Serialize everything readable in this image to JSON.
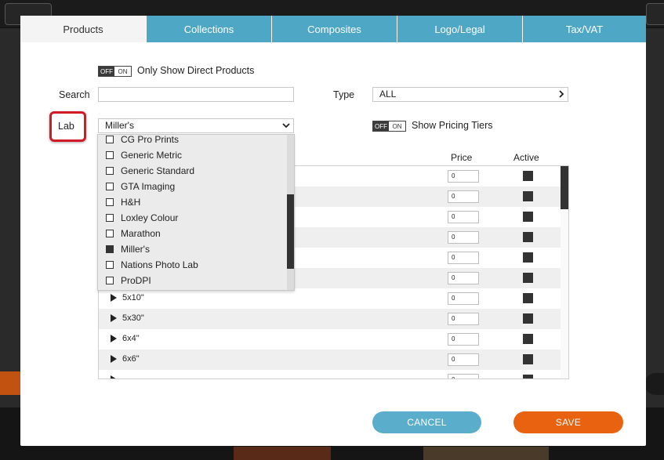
{
  "tabs": [
    {
      "label": "Products",
      "active": true
    },
    {
      "label": "Collections",
      "active": false
    },
    {
      "label": "Composites",
      "active": false
    },
    {
      "label": "Logo/Legal",
      "active": false
    },
    {
      "label": "Tax/VAT",
      "active": false
    }
  ],
  "toggles": {
    "off_text": "OFF",
    "on_text": "ON"
  },
  "direct_products": {
    "label": "Only Show Direct Products"
  },
  "search": {
    "label": "Search",
    "value": ""
  },
  "type": {
    "label": "Type",
    "value": "ALL"
  },
  "lab": {
    "label": "Lab",
    "selected": "Miller's",
    "options": [
      {
        "name": "CG Pro Prints",
        "checked": false
      },
      {
        "name": "Generic Metric",
        "checked": false
      },
      {
        "name": "Generic Standard",
        "checked": false
      },
      {
        "name": "GTA Imaging",
        "checked": false
      },
      {
        "name": "H&H",
        "checked": false
      },
      {
        "name": "Loxley Colour",
        "checked": false
      },
      {
        "name": "Marathon",
        "checked": false
      },
      {
        "name": "Miller's",
        "checked": true
      },
      {
        "name": "Nations Photo Lab",
        "checked": false
      },
      {
        "name": "ProDPI",
        "checked": false
      }
    ]
  },
  "pricing_tiers": {
    "label": "Show Pricing Tiers"
  },
  "table": {
    "columns": {
      "price": "Price",
      "active": "Active"
    },
    "rows": [
      {
        "size": "",
        "price": "0"
      },
      {
        "size": "",
        "price": "0"
      },
      {
        "size": "",
        "price": "0"
      },
      {
        "size": "",
        "price": "0"
      },
      {
        "size": "",
        "price": "0"
      },
      {
        "size": "",
        "price": "0"
      },
      {
        "size": "5x10\"",
        "price": "0"
      },
      {
        "size": "5x30\"",
        "price": "0"
      },
      {
        "size": "6x4\"",
        "price": "0"
      },
      {
        "size": "6x6\"",
        "price": "0"
      },
      {
        "size": "",
        "price": "0"
      }
    ]
  },
  "buttons": {
    "cancel": "CANCEL",
    "save": "SAVE"
  },
  "colors": {
    "tab_blue": "#4fa7c6",
    "save_orange": "#e8620f",
    "cancel_blue": "#5aaecb",
    "highlight_red": "#d11a26"
  },
  "icons": {
    "type_arrow": "chevron-right-icon",
    "lab_arrow": "chevron-down-icon",
    "row_expand": "triangle-right-icon"
  }
}
